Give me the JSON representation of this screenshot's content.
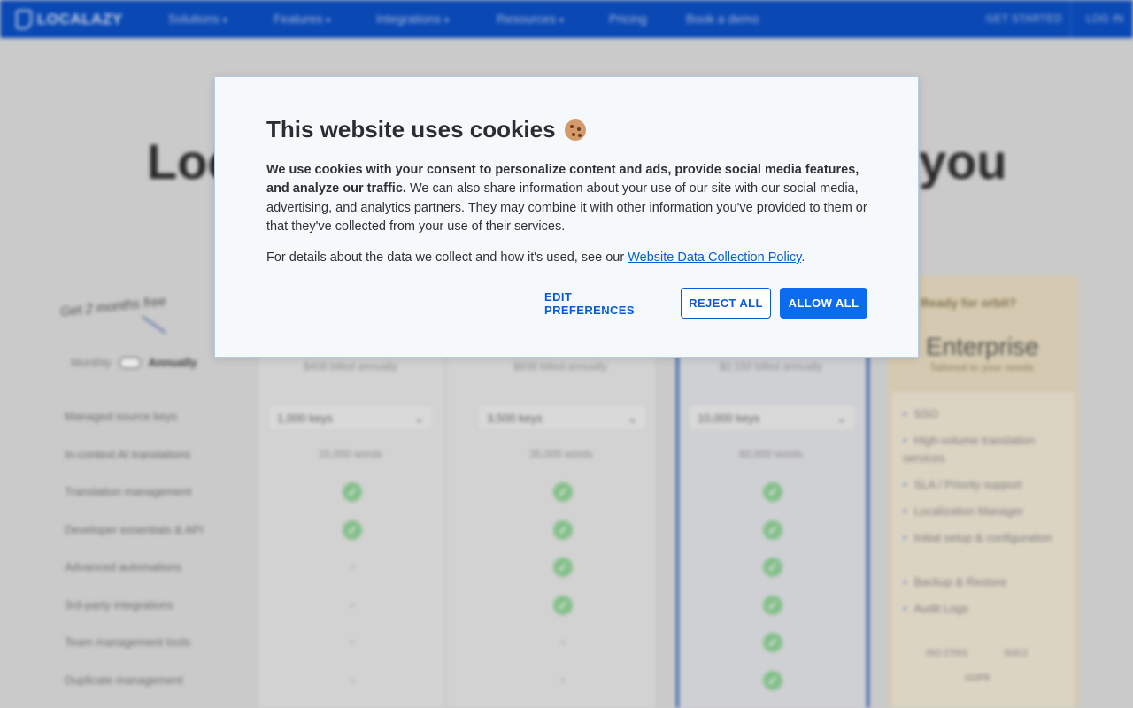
{
  "nav": {
    "logo": "LOCALAZY",
    "items": [
      "Solutions",
      "Features",
      "Integrations",
      "Resources",
      "Pricing",
      "Book a demo"
    ],
    "get_started": "GET STARTED",
    "login": "LOG IN"
  },
  "hero": {
    "left": "Loc",
    "right": "you"
  },
  "pricing": {
    "promo": "Get 2 months free",
    "toggle_monthly": "Monthly",
    "toggle_annually": "Annually",
    "billed": [
      "$408 billed annually",
      "$936 billed annually",
      "$2,150 billed annually"
    ],
    "keys": [
      "1,000 keys",
      "3,500 keys",
      "10,000 keys"
    ],
    "words": [
      "15,000 words",
      "35,000 words",
      "60,000 words"
    ],
    "features": [
      "Managed source keys",
      "In-context AI translations",
      "Translation management",
      "Developer essentials & API",
      "Advanced automations",
      "3rd-party integrations",
      "Team management tools",
      "Duplicate management"
    ],
    "enterprise": {
      "tag": "Ready for orbit?",
      "title": "Enterprise",
      "subtitle": "Tailored to your needs",
      "items": [
        "SSO",
        "High-volume translation services",
        "SLA / Priority support",
        "Localization Manager",
        "Initial setup & configuration",
        "Backup & Restore",
        "Audit Logs"
      ],
      "badges": [
        "ISO 27001",
        "SOC2",
        "GDPR"
      ]
    }
  },
  "cookie": {
    "title": "This website uses cookies",
    "body_bold": "We use cookies with your consent to personalize content and ads, provide social media features, and analyze our traffic.",
    "body_rest": " We can also share information about your use of our site with our social media, advertising, and analytics partners. They may combine it with other information you've provided to them or that they've collected from your use of their services.",
    "details_prefix": "For details about the data we collect and how it's used, see our ",
    "details_link": "Website Data Collection Policy",
    "details_suffix": ".",
    "edit_label": "EDIT PREFERENCES",
    "reject_label": "REJECT ALL",
    "allow_label": "ALLOW ALL"
  }
}
